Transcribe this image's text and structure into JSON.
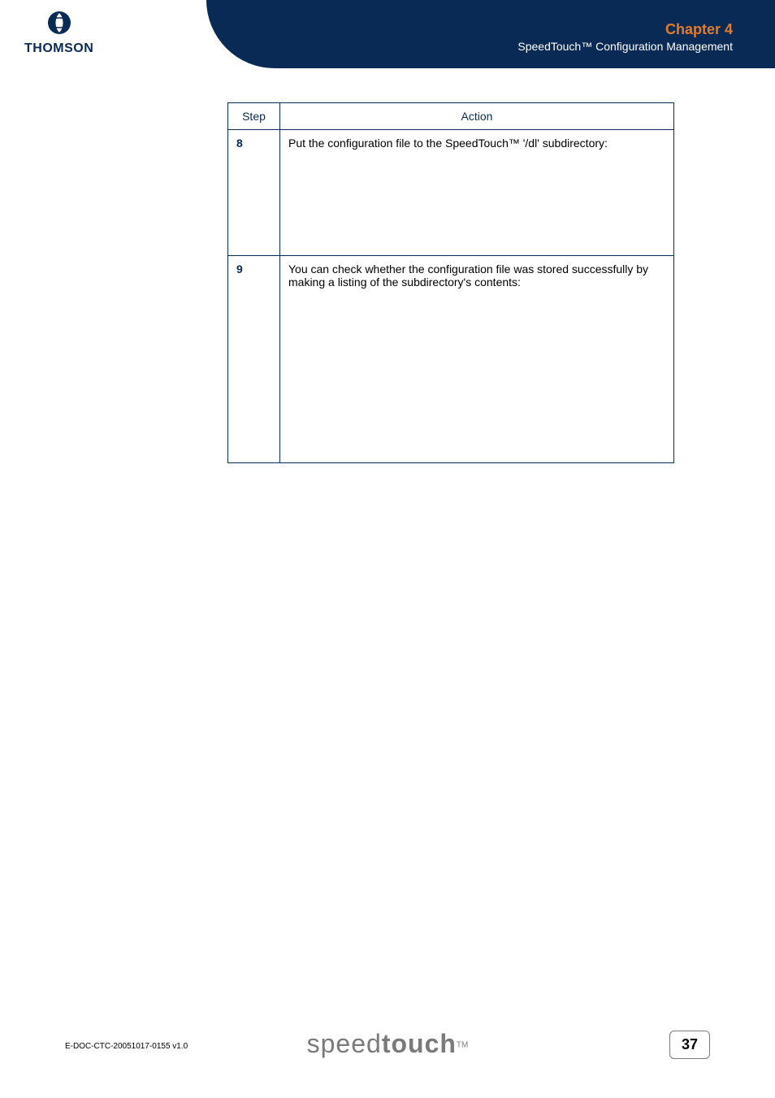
{
  "logo": {
    "brand": "THOMSON"
  },
  "header": {
    "chapter": "Chapter 4",
    "subtitle": "SpeedTouch™ Configuration Management"
  },
  "table": {
    "col_step": "Step",
    "col_action": "Action",
    "rows": [
      {
        "step": "8",
        "action": "Put the configuration file to the SpeedTouch™ '/dl' subdirectory:"
      },
      {
        "step": "9",
        "action": "You can check whether the configuration file was stored successfully by making a listing of the subdirectory's contents:"
      }
    ]
  },
  "footer": {
    "docid": "E-DOC-CTC-20051017-0155 v1.0",
    "brand_light": "speed",
    "brand_bold": "touch",
    "tm": "TM",
    "page": "37"
  }
}
